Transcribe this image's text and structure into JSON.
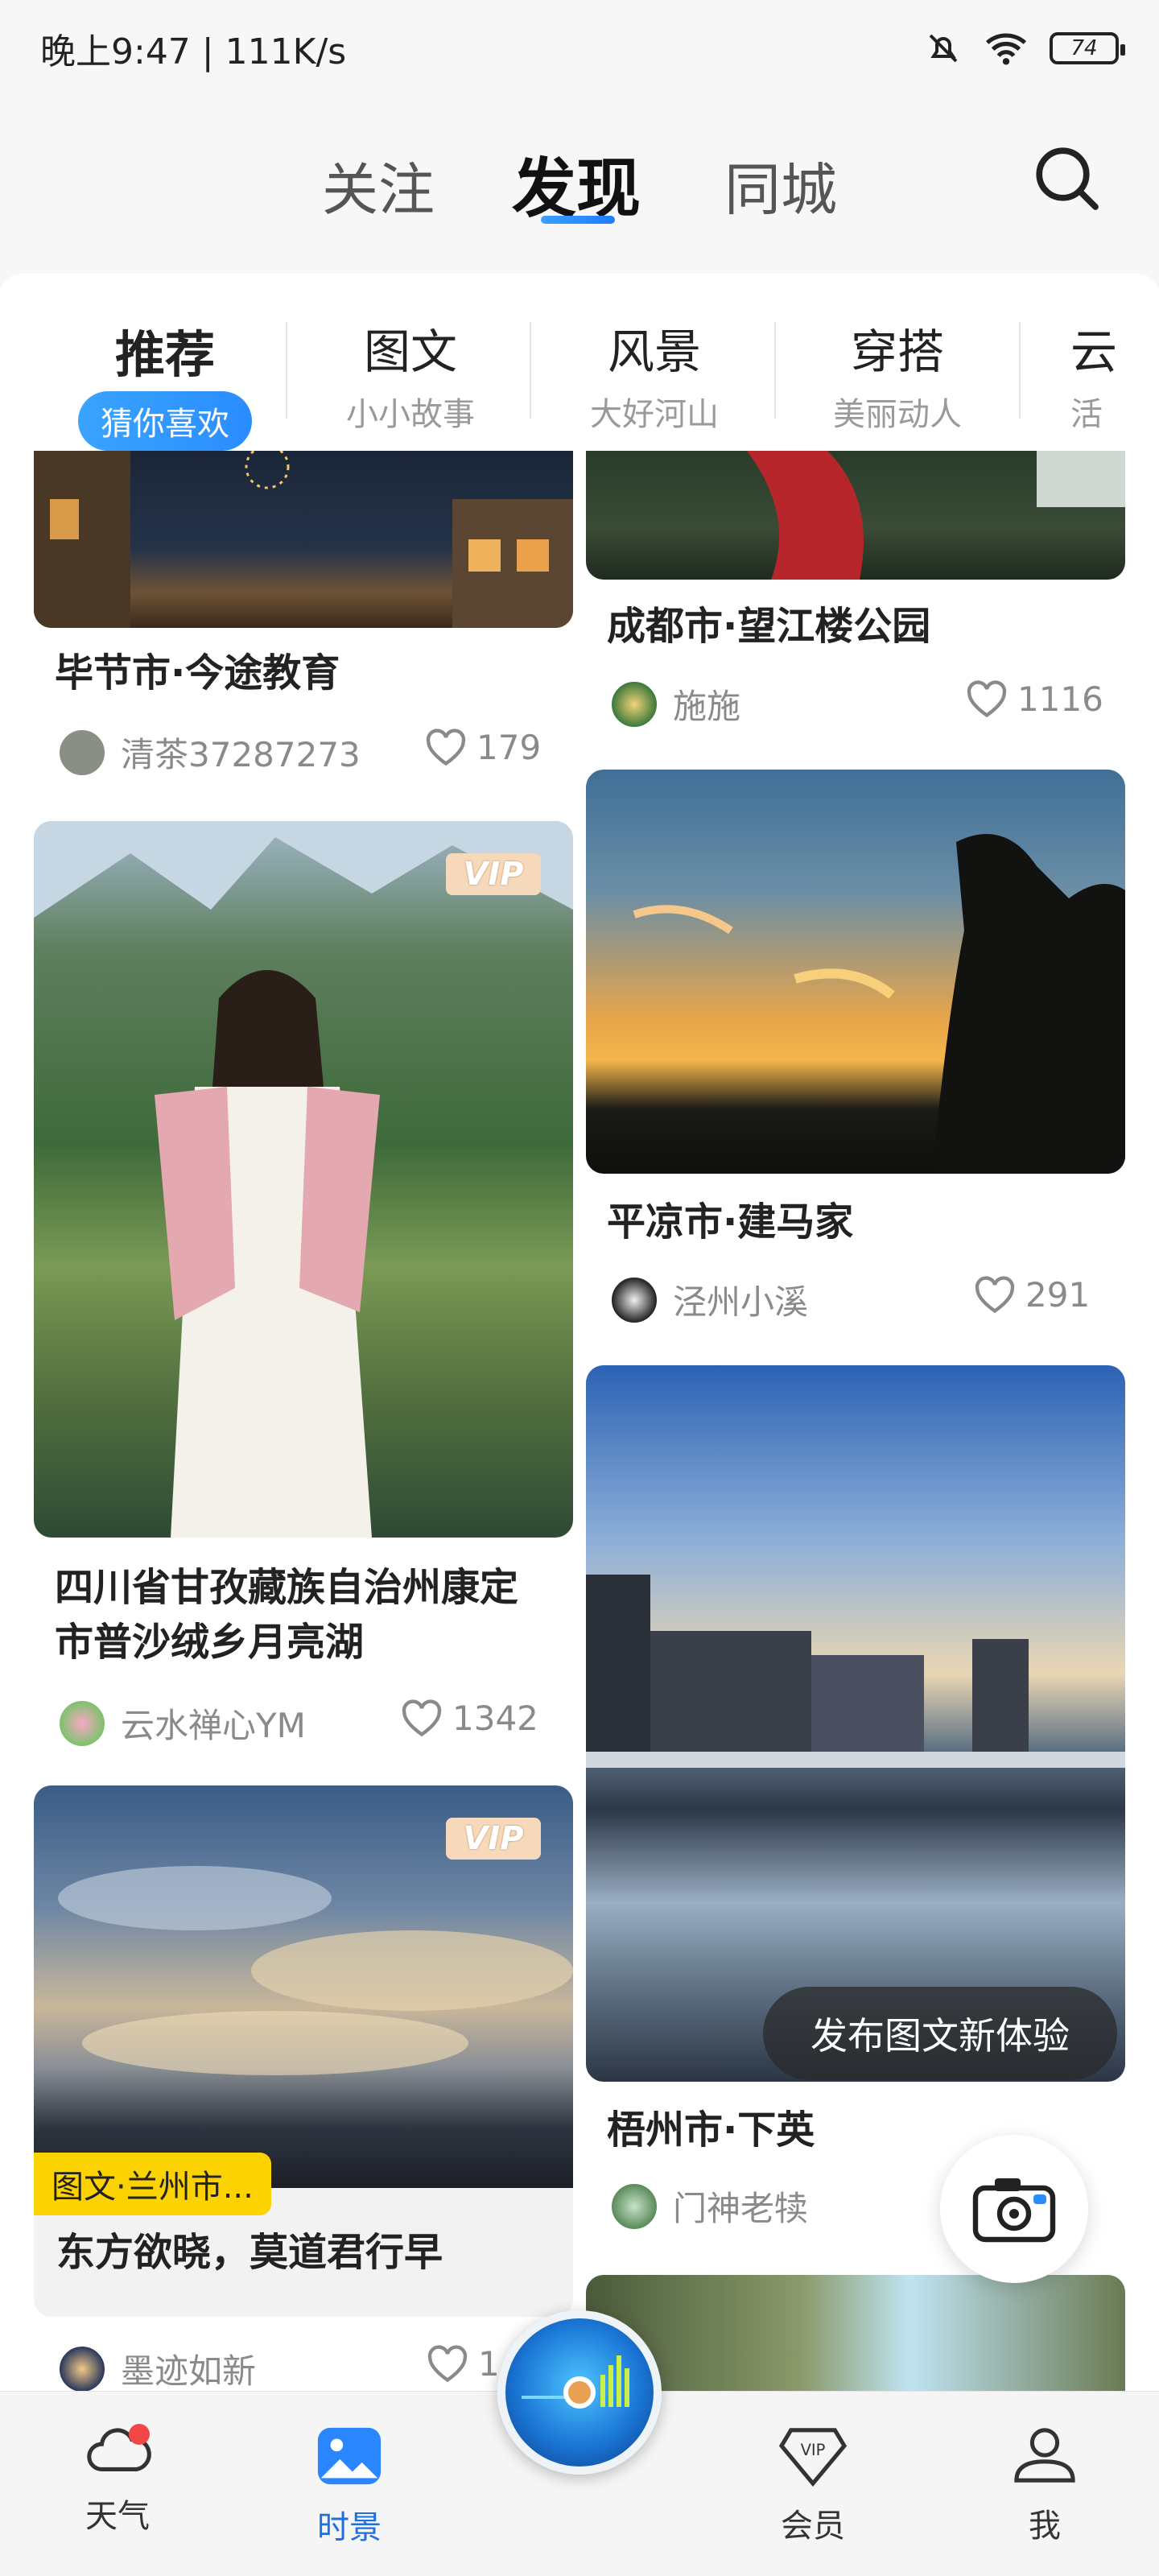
{
  "status": {
    "time": "晚上9:47 | 111K/s",
    "battery": "74"
  },
  "top_tabs": {
    "follow": "关注",
    "discover": "发现",
    "local": "同城"
  },
  "categories": [
    {
      "title": "推荐",
      "sub": "猜你喜欢"
    },
    {
      "title": "图文",
      "sub": "小小故事"
    },
    {
      "title": "风景",
      "sub": "大好河山"
    },
    {
      "title": "穿搭",
      "sub": "美丽动人"
    },
    {
      "title": "云",
      "sub": "活"
    }
  ],
  "cards": {
    "c1": {
      "title": "毕节市·今途教育",
      "user": "清茶37287273",
      "likes": "179"
    },
    "c2": {
      "title": "成都市·望江楼公园",
      "user": "施施",
      "likes": "1116"
    },
    "c3": {
      "title": "四川省甘孜藏族自治州康定市普沙绒乡月亮湖",
      "user": "云水禅心YM",
      "likes": "1342",
      "badge": "VIP"
    },
    "c4": {
      "title": "平凉市·建马家",
      "user": "泾州小溪",
      "likes": "291"
    },
    "c5": {
      "tag": "图文·兰州市...",
      "caption": "东方欲晓，莫道君行早",
      "user": "墨迹如新",
      "likes": "1",
      "badge": "VIP"
    },
    "c6": {
      "title": "梧州市·下英",
      "user": "门神老犊"
    }
  },
  "tooltip": "发布图文新体验",
  "bottom_nav": {
    "weather": "天气",
    "scenery": "时景",
    "vip": "会员",
    "me": "我"
  },
  "colors": {
    "accent": "#1f7dff",
    "tag": "#fcd200"
  }
}
